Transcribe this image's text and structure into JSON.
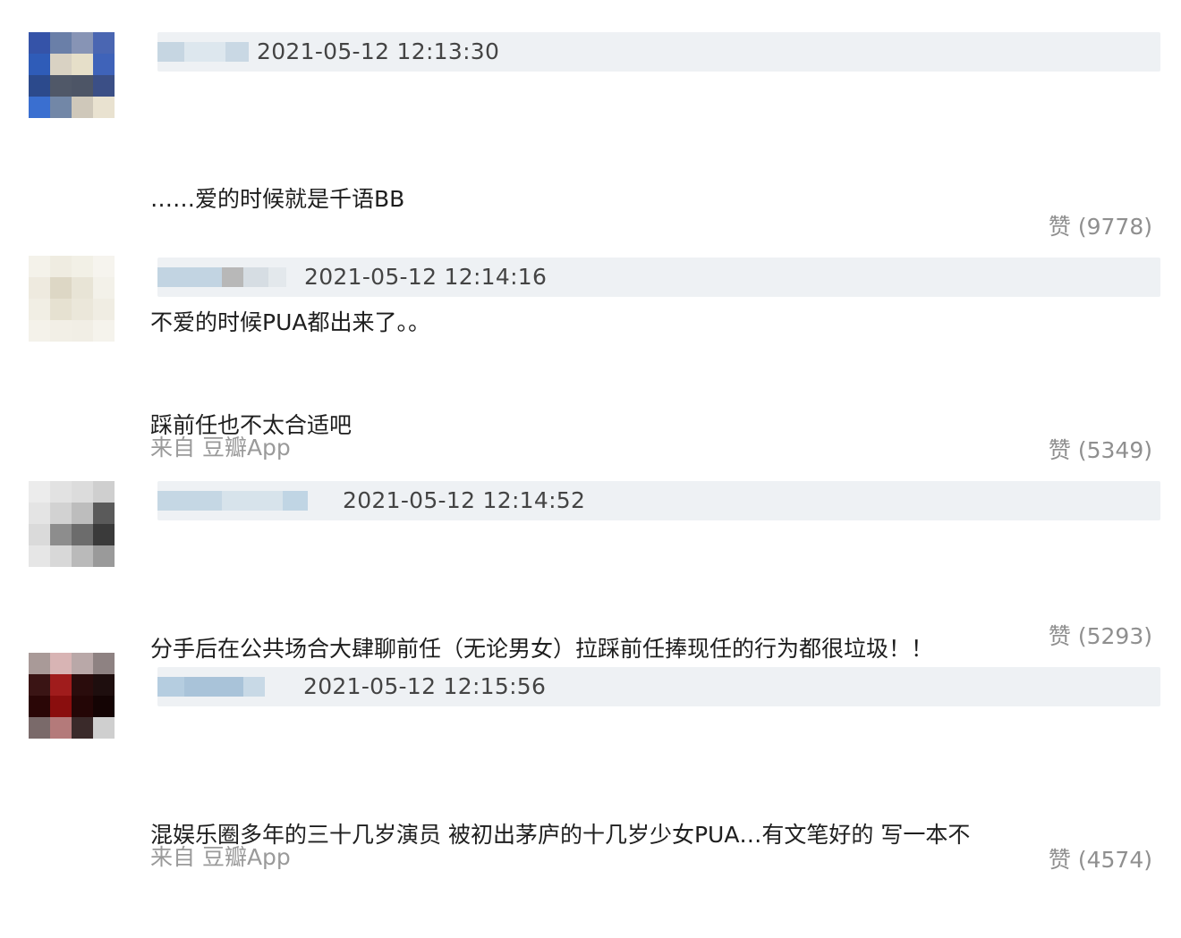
{
  "comments": [
    {
      "timestamp": "2021-05-12 12:13:30",
      "lines": [
        "……爱的时候就是千语BB",
        "不爱的时候PUA都出来了。。"
      ],
      "source": "",
      "likes": "赞 (9778)",
      "avatar_colors": [
        "#3553a8",
        "#6a7fa8",
        "#8794b5",
        "#4a66b2",
        "#2f5cb8",
        "#d9d2c3",
        "#e6dfc9",
        "#3f63b9",
        "#2c4a8c",
        "#505868",
        "#4d5566",
        "#3b4f86",
        "#3a6fd0",
        "#7287a7",
        "#cfc8ba",
        "#e9e2d0"
      ]
    },
    {
      "timestamp": "2021-05-12 12:14:16",
      "lines": [
        "踩前任也不太合适吧"
      ],
      "source": "来自 豆瓣App",
      "likes": "赞 (5349)",
      "avatar_colors": [
        "#f4f2ea",
        "#efece1",
        "#f2f0e6",
        "#f6f4ee",
        "#eeeadf",
        "#ddd7c5",
        "#e8e4d6",
        "#f3f1e9",
        "#f1eee4",
        "#e6e1d1",
        "#ebe7da",
        "#f0ede3",
        "#f4f2ea",
        "#f2efe6",
        "#f1eee5",
        "#f5f3ec"
      ]
    },
    {
      "timestamp": "2021-05-12 12:14:52",
      "lines": [
        "分手后在公共场合大肆聊前任（无论男女）拉踩前任捧现任的行为都很垃圾！！"
      ],
      "source": "",
      "likes": "赞 (5293)",
      "avatar_colors": [
        "#ececec",
        "#e2e2e2",
        "#dcdcdc",
        "#cfcfcf",
        "#e4e4e4",
        "#d2d2d2",
        "#bdbdbd",
        "#5a5a5a",
        "#dadada",
        "#8d8d8d",
        "#6c6c6c",
        "#3a3a3a",
        "#e6e6e6",
        "#d8d8d8",
        "#bababa",
        "#9a9a9a"
      ]
    },
    {
      "timestamp": "2021-05-12 12:15:56",
      "lines": [
        "混娱乐圈多年的三十几岁演员 被初出茅庐的十几岁少女PUA…有文笔好的 写一本不"
      ],
      "source": "来自 豆瓣App",
      "likes": "赞 (4574)",
      "avatar_colors": [
        "#a99a98",
        "#d8b4b4",
        "#b9a8a8",
        "#8e8282",
        "#3a1414",
        "#a01c1c",
        "#2a0c0c",
        "#1e0e0e",
        "#2a0606",
        "#8a0e0e",
        "#240606",
        "#140404",
        "#7a6a6a",
        "#b47a7a",
        "#3a2a2a",
        "#cfcfcf"
      ]
    }
  ],
  "blur_colors": {
    "c0": [
      "#c6d6e2",
      "#dde7ee",
      "#c9d8e4"
    ],
    "c1": [
      "#c2d4e2",
      "#b8b8b8",
      "#d6dde3",
      "#e3e8ec"
    ],
    "c2": [
      "#c5d7e4",
      "#d7e3eb",
      "#c0d5e4"
    ],
    "c3": [
      "#b5cde0",
      "#a9c3d9",
      "#c8d9e6"
    ]
  }
}
